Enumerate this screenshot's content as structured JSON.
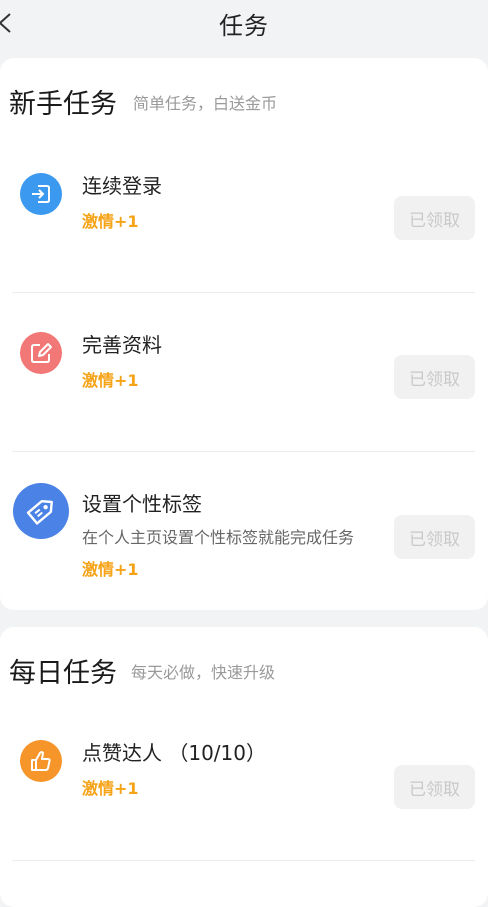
{
  "header": {
    "title": "任务"
  },
  "novice": {
    "title": "新手任务",
    "subtitle": "简单任务，白送金币",
    "tasks": [
      {
        "title": "连续登录",
        "desc": "",
        "reward": "激情+1",
        "button": "已领取",
        "icon": "login-icon",
        "icon_color": "#3b9af0"
      },
      {
        "title": "完善资料",
        "desc": "",
        "reward": "激情+1",
        "button": "已领取",
        "icon": "edit-icon",
        "icon_color": "#f27777"
      },
      {
        "title": "设置个性标签",
        "desc": "在个人主页设置个性标签就能完成任务",
        "reward": "激情+1",
        "button": "已领取",
        "icon": "tag-icon",
        "icon_color": "#4a82e6"
      }
    ]
  },
  "daily": {
    "title": "每日任务",
    "subtitle": "每天必做，快速升级",
    "tasks": [
      {
        "title": "点赞达人 （10/10）",
        "desc": "",
        "reward": "激情+1",
        "button": "已领取",
        "icon": "thumbs-up-icon",
        "icon_color": "#f5952a"
      }
    ]
  },
  "colors": {
    "reward": "#f5a317",
    "background": "#f2f3f5",
    "button_bg": "#f1f1f1",
    "button_text": "#c9c9c9"
  }
}
